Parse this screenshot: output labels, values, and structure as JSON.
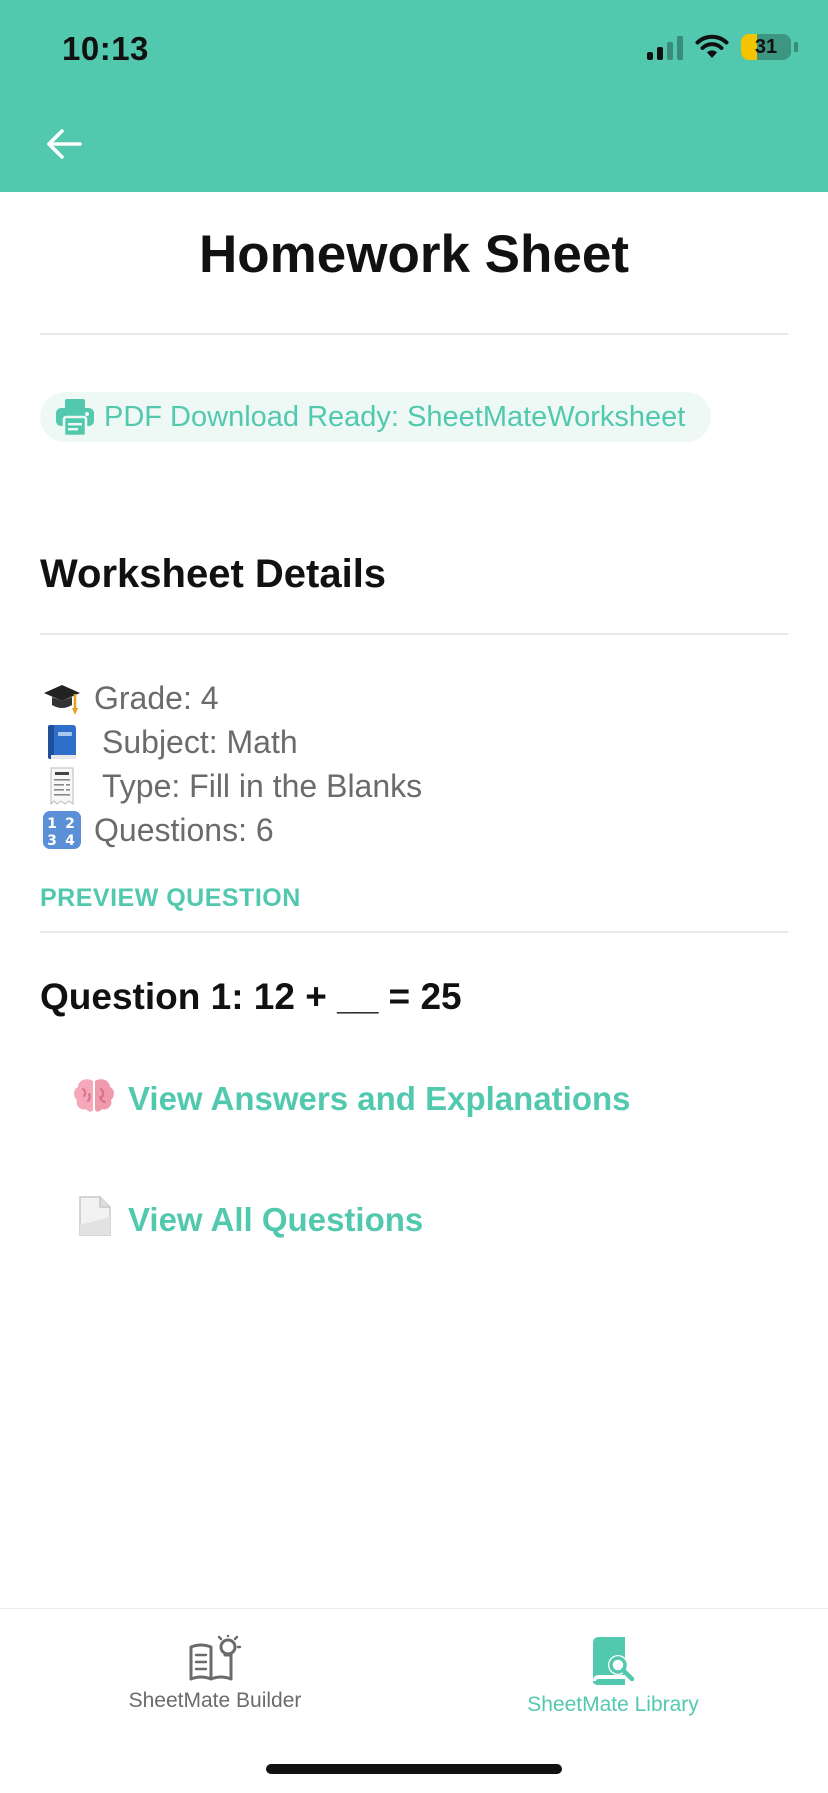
{
  "status_bar": {
    "time": "10:13",
    "battery": "31"
  },
  "header": {
    "title": "Homework Sheet"
  },
  "pdf": {
    "label": "PDF Download Ready: SheetMateWorksheet"
  },
  "details": {
    "title": "Worksheet Details",
    "grade": "Grade: 4",
    "subject": "Subject: Math",
    "type": "Type: Fill in the Blanks",
    "questions": "Questions: 6"
  },
  "preview": {
    "label": "PREVIEW QUESTION",
    "question": "Question 1: 12 + __ = 25"
  },
  "links": {
    "answers": "View Answers and Explanations",
    "all_questions": "View All Questions"
  },
  "tabbar": {
    "builder": "SheetMate Builder",
    "library": "SheetMate Library"
  },
  "colors": {
    "accent": "#52C9AE",
    "inactive_tab": "#6b6b6b"
  }
}
